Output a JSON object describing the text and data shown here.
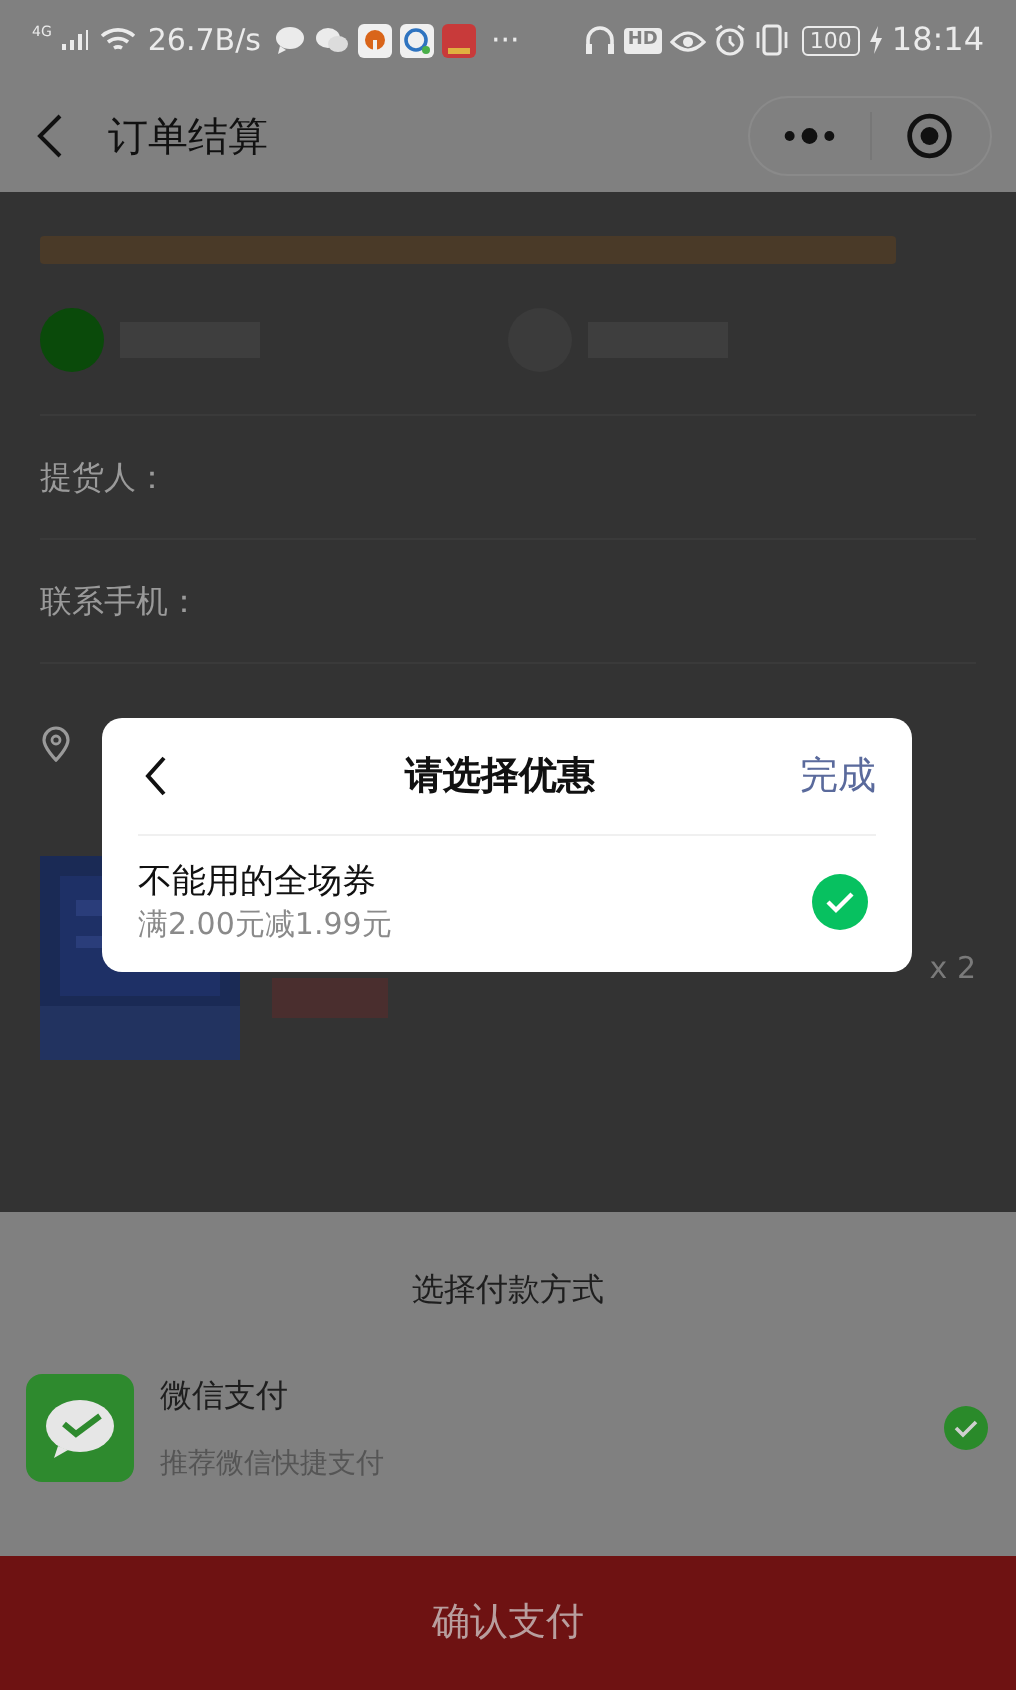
{
  "status_bar": {
    "network": "4G",
    "speed": "26.7B/s",
    "more": "···",
    "hd": "HD",
    "battery": "100",
    "time": "18:14"
  },
  "nav": {
    "title": "订单结算"
  },
  "order": {
    "pickup_options": [
      {
        "selected": true
      },
      {
        "selected": false
      }
    ],
    "fields": [
      {
        "label": "提货人："
      },
      {
        "label": "联系手机："
      }
    ],
    "quantity": "x 2"
  },
  "coupon_dialog": {
    "title": "请选择优惠",
    "done": "完成",
    "coupons": [
      {
        "name": "不能用的全场券",
        "rule": "满2.00元减1.99元",
        "selected": true
      }
    ]
  },
  "payment": {
    "title": "选择付款方式",
    "methods": [
      {
        "name": "微信支付",
        "note": "推荐微信快捷支付",
        "selected": true
      }
    ],
    "confirm": "确认支付"
  }
}
